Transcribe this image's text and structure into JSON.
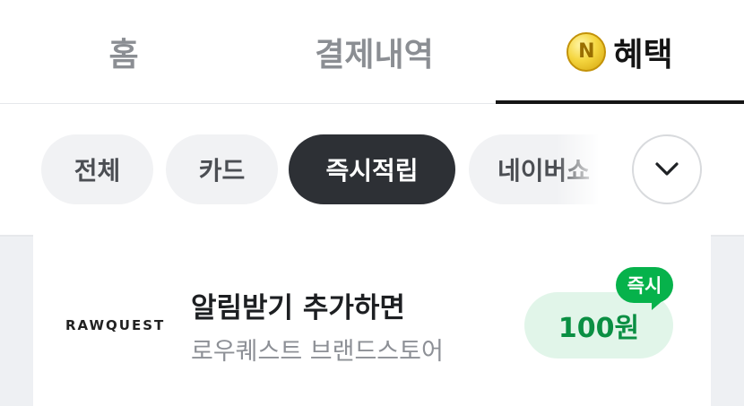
{
  "tabs": {
    "home": "홈",
    "history": "결제내역",
    "benefits": "혜택",
    "benefits_icon": "naver-coin-icon",
    "coin_letter": "N"
  },
  "filters": {
    "chips": [
      "전체",
      "카드",
      "즉시적립",
      "네이버쇼"
    ],
    "selected": "즉시적립",
    "expand_icon": "chevron-down-icon"
  },
  "offer": {
    "brand_logo": "RAWQUEST",
    "title": "알림받기 추가하면",
    "subtitle": "로우퀘스트 브랜드스토어",
    "reward": "100원",
    "badge": "즉시"
  },
  "colors": {
    "active_chip": "#2d3035",
    "reward_bg": "#e1f5e9",
    "reward_text": "#0a8f43",
    "badge": "#06b24b"
  }
}
